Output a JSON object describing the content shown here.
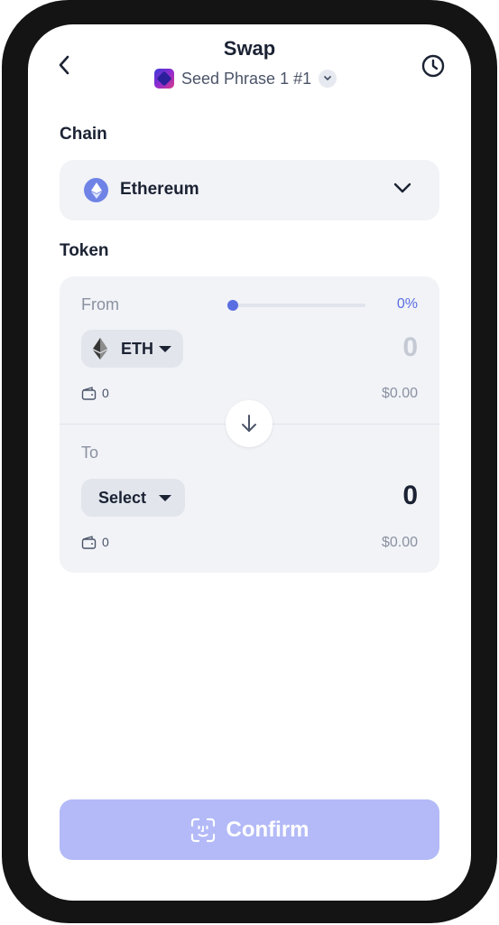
{
  "header": {
    "title": "Swap",
    "wallet_name": "Seed Phrase 1 #1",
    "back_icon": "chevron-left-icon",
    "history_icon": "clock-icon"
  },
  "chain": {
    "section_label": "Chain",
    "selected": "Ethereum",
    "icon": "ethereum-icon"
  },
  "token": {
    "section_label": "Token",
    "from": {
      "label": "From",
      "token": "ETH",
      "amount": "0",
      "balance": "0",
      "usd_value": "$0.00",
      "percent_label": "0%",
      "percent": 0
    },
    "to": {
      "label": "To",
      "token": "Select",
      "amount": "0",
      "balance": "0",
      "usd_value": "$0.00"
    }
  },
  "confirm": {
    "label": "Confirm",
    "icon": "face-id-icon"
  },
  "colors": {
    "accent": "#5b6ee1",
    "confirm_disabled": "#b3baf7",
    "card_bg": "#f1f3f7"
  }
}
